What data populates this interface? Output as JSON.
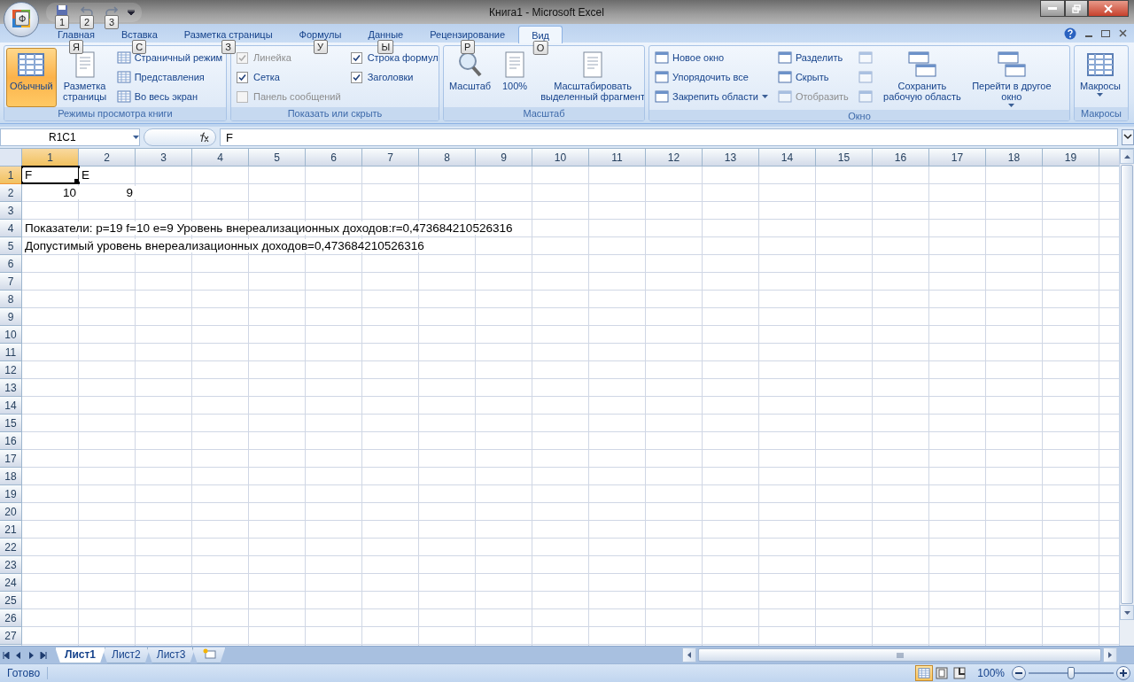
{
  "window": {
    "title": "Книга1 - Microsoft Excel"
  },
  "office_button": {
    "keytip": "Ф"
  },
  "quick_access": [
    {
      "kind": "save",
      "keytip": "1",
      "disabled": false
    },
    {
      "kind": "undo",
      "keytip": "2",
      "disabled": true
    },
    {
      "kind": "redo",
      "keytip": "3",
      "disabled": true
    }
  ],
  "tabs": [
    {
      "label": "Главная",
      "selected": false,
      "keytip": "Я"
    },
    {
      "label": "Вставка",
      "selected": false,
      "keytip": "С"
    },
    {
      "label": "Разметка страницы",
      "selected": false,
      "keytip": "З"
    },
    {
      "label": "Формулы",
      "selected": false,
      "keytip": "У"
    },
    {
      "label": "Данные",
      "selected": false,
      "keytip": "Ы"
    },
    {
      "label": "Рецензирование",
      "selected": false,
      "keytip": "Р"
    },
    {
      "label": "Вид",
      "selected": true,
      "keytip": "О"
    }
  ],
  "ribbon": {
    "groups": [
      {
        "label": "Режимы просмотра книги",
        "items": [
          {
            "kind": "large",
            "label": "Обычный",
            "selected": true,
            "disabled": false,
            "dropdown": false
          },
          {
            "kind": "large",
            "label": "Разметка страницы",
            "selected": false,
            "disabled": false,
            "dropdown": false
          },
          {
            "kind": "small",
            "label": "Страничный режим",
            "selected": false,
            "disabled": false,
            "dropdown": false
          },
          {
            "kind": "small",
            "label": "Представления",
            "selected": false,
            "disabled": false,
            "dropdown": false
          },
          {
            "kind": "small",
            "label": "Во весь экран",
            "selected": false,
            "disabled": false,
            "dropdown": false
          }
        ]
      },
      {
        "label": "Показать или скрыть",
        "items": [
          {
            "kind": "check",
            "label": "Линейка",
            "checked": true,
            "disabled": true
          },
          {
            "kind": "check",
            "label": "Сетка",
            "checked": true,
            "disabled": false
          },
          {
            "kind": "check",
            "label": "Панель сообщений",
            "checked": false,
            "disabled": true
          },
          {
            "kind": "check",
            "label": "Строка формул",
            "checked": true,
            "disabled": false
          },
          {
            "kind": "check",
            "label": "Заголовки",
            "checked": true,
            "disabled": false
          }
        ]
      },
      {
        "label": "Масштаб",
        "items": [
          {
            "kind": "large",
            "label": "Масштаб",
            "selected": false,
            "disabled": false,
            "dropdown": false
          },
          {
            "kind": "large",
            "label": "100%",
            "selected": false,
            "disabled": false,
            "dropdown": false
          },
          {
            "kind": "large",
            "label": "Масштабировать выделенный фрагмент",
            "selected": false,
            "disabled": false,
            "dropdown": false
          }
        ]
      },
      {
        "label": "Окно",
        "items": [
          {
            "kind": "small",
            "label": "Новое окно",
            "selected": false,
            "disabled": false,
            "dropdown": false
          },
          {
            "kind": "small",
            "label": "Упорядочить все",
            "selected": false,
            "disabled": false,
            "dropdown": false
          },
          {
            "kind": "small",
            "label": "Закрепить области",
            "selected": false,
            "disabled": false,
            "dropdown": true
          },
          {
            "kind": "small",
            "label": "Разделить",
            "selected": false,
            "disabled": false,
            "dropdown": false
          },
          {
            "kind": "small",
            "label": "Скрыть",
            "selected": false,
            "disabled": false,
            "dropdown": false
          },
          {
            "kind": "small",
            "label": "Отобразить",
            "selected": false,
            "disabled": true,
            "dropdown": false
          },
          {
            "kind": "icon",
            "selected": false,
            "disabled": true,
            "dropdown": false
          },
          {
            "kind": "icon",
            "selected": false,
            "disabled": true,
            "dropdown": false
          },
          {
            "kind": "icon",
            "selected": false,
            "disabled": true,
            "dropdown": false
          },
          {
            "kind": "large",
            "label": "Сохранить рабочую область",
            "selected": false,
            "disabled": false,
            "dropdown": false
          },
          {
            "kind": "large",
            "label": "Перейти в другое окно",
            "selected": false,
            "disabled": false,
            "dropdown": true
          }
        ]
      },
      {
        "label": "Макросы",
        "items": [
          {
            "kind": "large",
            "label": "Макросы",
            "selected": false,
            "disabled": false,
            "dropdown": true
          }
        ]
      }
    ]
  },
  "formula_bar": {
    "name_box": "R1C1",
    "formula": "F"
  },
  "sheet": {
    "columns": [
      {
        "label": "1",
        "selected": true
      },
      {
        "label": "2",
        "selected": false
      },
      {
        "label": "3",
        "selected": false
      },
      {
        "label": "4",
        "selected": false
      },
      {
        "label": "5",
        "selected": false
      },
      {
        "label": "6",
        "selected": false
      },
      {
        "label": "7",
        "selected": false
      },
      {
        "label": "8",
        "selected": false
      },
      {
        "label": "9",
        "selected": false
      },
      {
        "label": "10",
        "selected": false
      },
      {
        "label": "11",
        "selected": false
      },
      {
        "label": "12",
        "selected": false
      },
      {
        "label": "13",
        "selected": false
      },
      {
        "label": "14",
        "selected": false
      },
      {
        "label": "15",
        "selected": false
      },
      {
        "label": "16",
        "selected": false
      },
      {
        "label": "17",
        "selected": false
      },
      {
        "label": "18",
        "selected": false
      },
      {
        "label": "19",
        "selected": false
      }
    ],
    "rows": [
      {
        "label": "1",
        "selected": true,
        "cells": [
          {
            "kind": "text",
            "text": "F",
            "selected": true
          },
          {
            "kind": "text",
            "text": "E",
            "selected": false
          }
        ]
      },
      {
        "label": "2",
        "selected": false,
        "cells": [
          {
            "kind": "number",
            "text": "10",
            "selected": false
          },
          {
            "kind": "number",
            "text": "9",
            "selected": false
          }
        ]
      },
      {
        "label": "3",
        "selected": false
      },
      {
        "label": "4",
        "selected": false,
        "cells": [
          {
            "kind": "text",
            "text": "Показатели: p=19 f=10 e=9 Уровень внереализационных доходов:r=0,473684210526316",
            "selected": false
          }
        ]
      },
      {
        "label": "5",
        "selected": false,
        "cells": [
          {
            "kind": "text",
            "text": "Допустимый уровень внереализационных доходов=0,473684210526316",
            "selected": false
          }
        ]
      },
      {
        "label": "6",
        "selected": false
      },
      {
        "label": "7",
        "selected": false
      },
      {
        "label": "8",
        "selected": false
      },
      {
        "label": "9",
        "selected": false
      },
      {
        "label": "10",
        "selected": false
      },
      {
        "label": "11",
        "selected": false
      },
      {
        "label": "12",
        "selected": false
      },
      {
        "label": "13",
        "selected": false
      },
      {
        "label": "14",
        "selected": false
      },
      {
        "label": "15",
        "selected": false
      },
      {
        "label": "16",
        "selected": false
      },
      {
        "label": "17",
        "selected": false
      },
      {
        "label": "18",
        "selected": false
      },
      {
        "label": "19",
        "selected": false
      },
      {
        "label": "20",
        "selected": false
      },
      {
        "label": "21",
        "selected": false
      },
      {
        "label": "22",
        "selected": false
      },
      {
        "label": "23",
        "selected": false
      },
      {
        "label": "24",
        "selected": false
      },
      {
        "label": "25",
        "selected": false
      },
      {
        "label": "26",
        "selected": false
      },
      {
        "label": "27",
        "selected": false
      }
    ]
  },
  "sheet_tabs": [
    {
      "label": "Лист1",
      "selected": true
    },
    {
      "label": "Лист2",
      "selected": false
    },
    {
      "label": "Лист3",
      "selected": false
    }
  ],
  "status_bar": {
    "status": "Готово",
    "views": [
      {
        "kind": "normal",
        "selected": true
      },
      {
        "kind": "layout",
        "selected": false
      },
      {
        "kind": "page_break",
        "selected": false
      }
    ],
    "zoom": "100%",
    "zoom_slider": {
      "level": 0.5
    }
  }
}
